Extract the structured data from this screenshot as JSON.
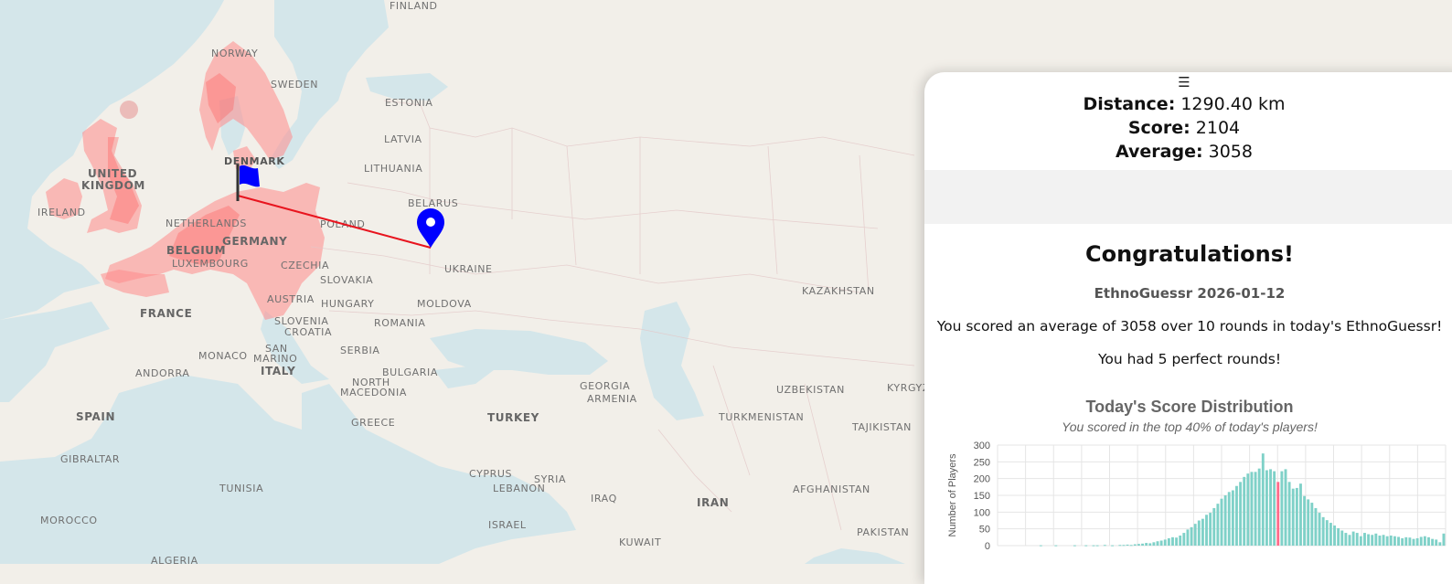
{
  "map": {
    "countries": {
      "finland": "FINLAND",
      "norway": "NORWAY",
      "sweden": "SWEDEN",
      "estonia": "ESTONIA",
      "latvia": "LATVIA",
      "lithuania": "LITHUANIA",
      "denmark": "DENMARK",
      "united_kingdom": "UNITED",
      "united_kingdom_2": "KINGDOM",
      "ireland": "IRELAND",
      "netherlands": "NETHERLANDS",
      "belarus": "BELARUS",
      "poland": "POLAND",
      "belgium": "BELGIUM",
      "germany": "GERMANY",
      "luxembourg": "LUXEMBOURG",
      "czechia": "CZECHIA",
      "ukraine": "UKRAINE",
      "slovakia": "SLOVAKIA",
      "kazakhstan": "KAZAKHSTAN",
      "austria": "AUSTRIA",
      "hungary": "HUNGARY",
      "moldova": "MOLDOVA",
      "france": "FRANCE",
      "slovenia": "SLOVENIA",
      "croatia": "CROATIA",
      "romania": "ROMANIA",
      "monaco": "MONACO",
      "san_marino": "SAN",
      "san_marino_2": "MARINO",
      "serbia": "SERBIA",
      "andorra": "ANDORRA",
      "italy": "ITALY",
      "bulgaria": "BULGARIA",
      "north_macedonia": "NORTH",
      "north_macedonia_2": "MACEDONIA",
      "georgia": "GEORGIA",
      "armenia": "ARMENIA",
      "uzbekistan": "UZBEKISTAN",
      "kyrgyz": "KYRGYZ",
      "spain": "SPAIN",
      "greece": "GREECE",
      "turkey": "TURKEY",
      "turkmenistan": "TURKMENISTAN",
      "tajikistan": "TAJIKISTAN",
      "gibraltar": "GIBRALTAR",
      "tunisia": "TUNISIA",
      "cyprus": "CYPRUS",
      "syria": "SYRIA",
      "lebanon": "LEBANON",
      "afghanistan": "AFGHANISTAN",
      "iraq": "IRAQ",
      "iran": "IRAN",
      "morocco": "MOROCCO",
      "israel": "ISRAEL",
      "pakistan": "PAKISTAN",
      "kuwait": "KUWAIT",
      "algeria": "ALGERIA"
    },
    "colors": {
      "water": "#d4e6ea",
      "land": "#f2efe9",
      "region_fill": "#ff8a8a",
      "line": "#e8141e",
      "guess_marker": "#0000ff"
    },
    "icons": {
      "guess": "map-pin-icon",
      "answer": "flag-icon"
    }
  },
  "panel": {
    "menu_icon": "☰",
    "distance_label": "Distance:",
    "distance_value": "1290.40 km",
    "score_label": "Score:",
    "score_value": "2104",
    "average_label": "Average:",
    "average_value": "3058",
    "congrats": "Congratulations!",
    "game_date": "EthnoGuessr 2026-01-12",
    "summary": "You scored an average of 3058 over 10 rounds in today's EthnoGuessr!",
    "perfect": "You had 5 perfect rounds!",
    "chart_title": "Today's Score Distribution",
    "chart_subtitle": "You scored in the top 40% of today's players!"
  },
  "chart_data": {
    "type": "bar",
    "ylabel": "Number of Players",
    "ylim": [
      0,
      300
    ],
    "yticks": [
      "0",
      "50",
      "100",
      "150",
      "200",
      "250",
      "300"
    ],
    "highlight_index": 74,
    "colors": {
      "bar": "#7fd1c8",
      "highlight": "#ff6b8b",
      "grid": "#e5e5e5"
    },
    "values": [
      0,
      0,
      0,
      0,
      0,
      0,
      0,
      0,
      0,
      0,
      0,
      1,
      0,
      0,
      0,
      1,
      0,
      0,
      0,
      0,
      1,
      0,
      0,
      1,
      0,
      1,
      1,
      0,
      2,
      0,
      1,
      0,
      2,
      2,
      3,
      2,
      4,
      5,
      6,
      8,
      7,
      10,
      13,
      15,
      18,
      22,
      25,
      24,
      30,
      38,
      48,
      55,
      65,
      75,
      80,
      92,
      98,
      112,
      125,
      140,
      150,
      160,
      165,
      178,
      190,
      205,
      215,
      220,
      220,
      230,
      275,
      225,
      228,
      222,
      190,
      222,
      228,
      190,
      170,
      172,
      185,
      148,
      138,
      128,
      112,
      98,
      85,
      76,
      68,
      60,
      52,
      45,
      38,
      32,
      42,
      38,
      28,
      38,
      34,
      32,
      36,
      30,
      32,
      28,
      30,
      28,
      26,
      22,
      25,
      24,
      20,
      22,
      26,
      28,
      25,
      20,
      18,
      10,
      36
    ],
    "values_observed": "approximate"
  }
}
